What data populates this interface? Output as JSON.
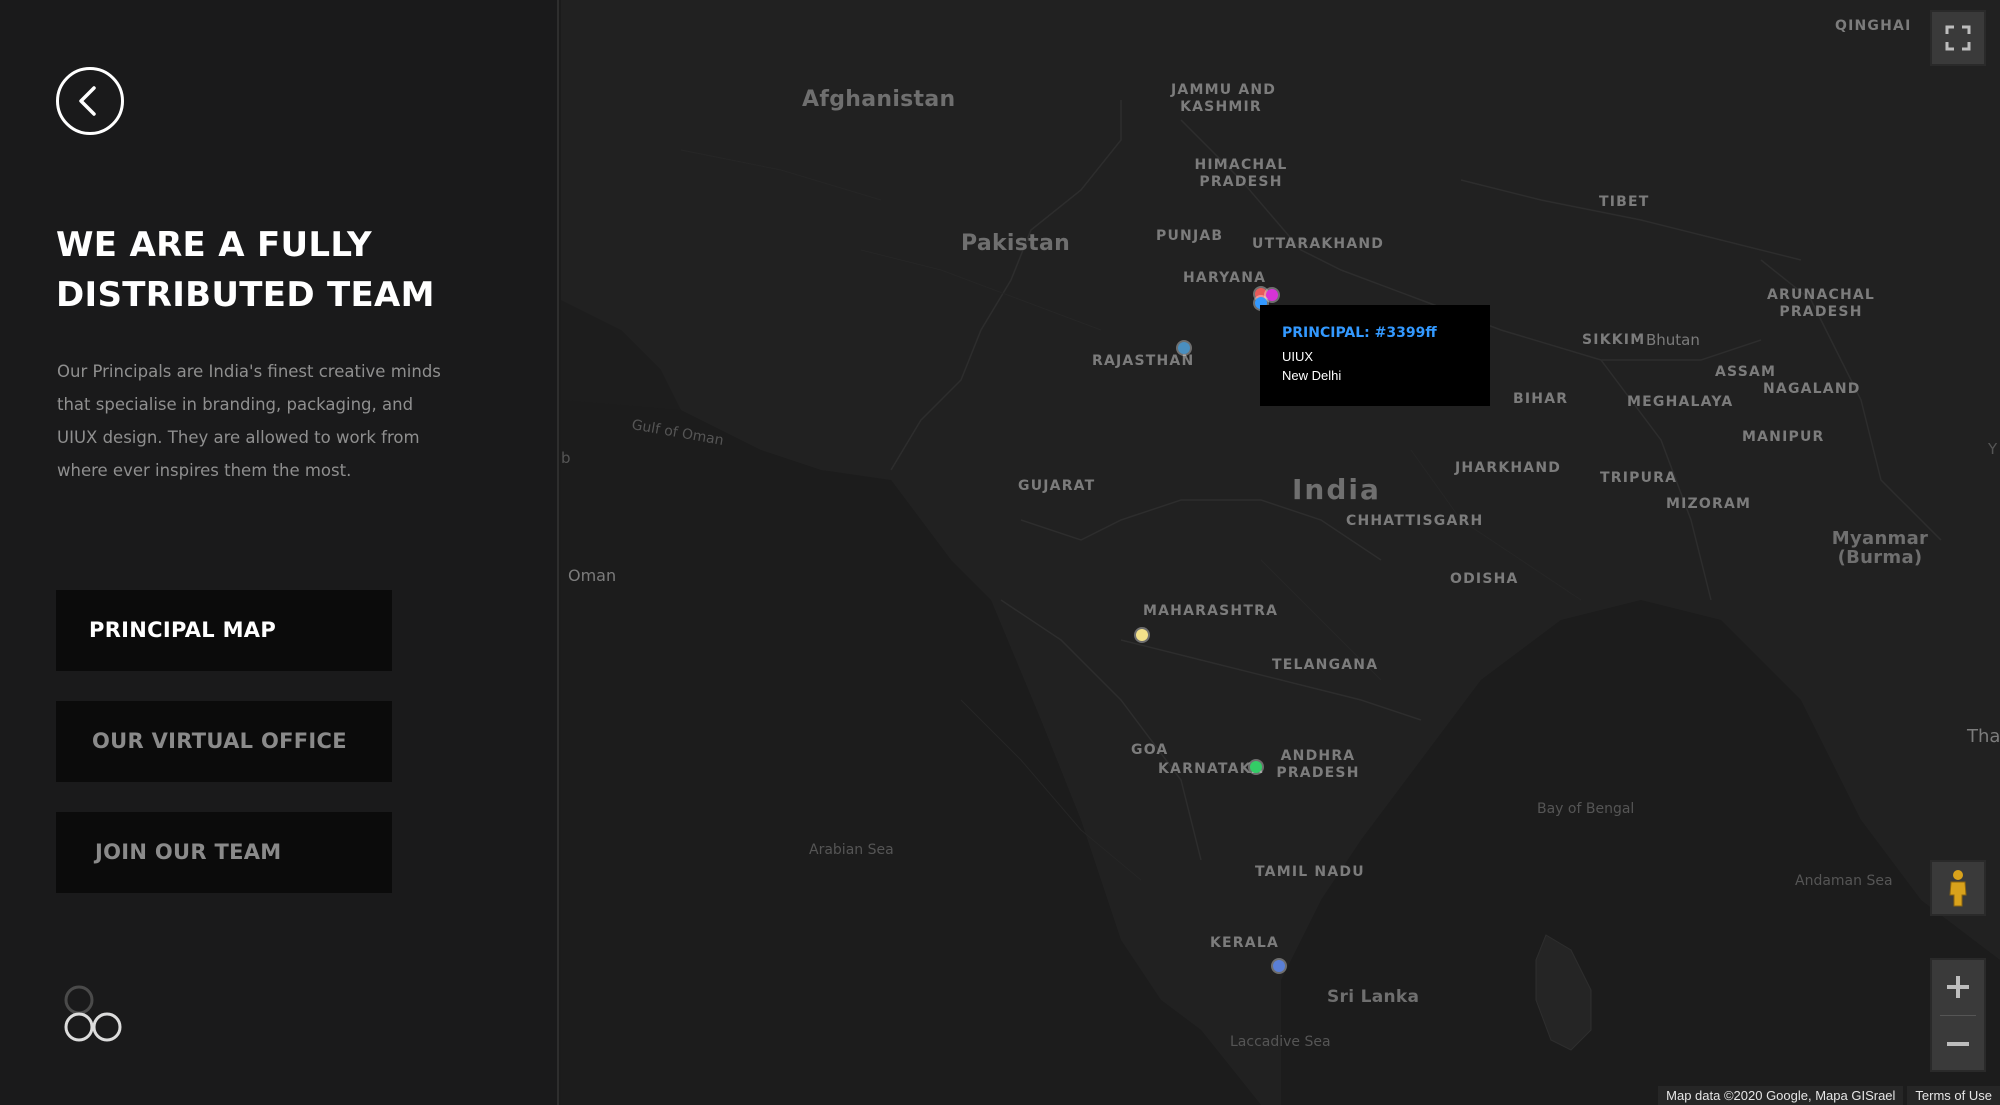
{
  "sidebar": {
    "headline_line1": "WE ARE A FULLY",
    "headline_line2": "DISTRIBUTED TEAM",
    "intro_line1": "Our Principals are India's finest creative minds",
    "intro_line2": "that specialise in branding, packaging, and",
    "intro_line3": "UIUX design. They are allowed to work from",
    "intro_line4": "where ever inspires them the most.",
    "nav": {
      "principal_map": "PRINCIPAL MAP",
      "virtual_office": "OUR VIRTUAL OFFICE",
      "join_team": "JOIN OUR TEAM"
    }
  },
  "map": {
    "labels": {
      "qinghai": "QINGHAI",
      "afghanistan": "Afghanistan",
      "jammu1": "JAMMU AND",
      "jammu2": "KASHMIR",
      "himachal1": "HIMACHAL",
      "himachal2": "PRADESH",
      "tibet": "TIBET",
      "pakistan": "Pakistan",
      "punjab": "PUNJAB",
      "uttarakhand": "UTTARAKHAND",
      "haryana": "HARYANA",
      "arunachal1": "ARUNACHAL",
      "arunachal2": "PRADESH",
      "rajasthan": "RAJASTHAN",
      "sikkim": "SIKKIM",
      "bhutan": "Bhutan",
      "assam": "ASSAM",
      "nagaland": "NAGALAND",
      "gulf_of_oman": "Gulf of Oman",
      "bihar": "BIHAR",
      "meghalaya": "MEGHALAYA",
      "manipur": "MANIPUR",
      "gujarat": "GUJARAT",
      "india": "India",
      "jharkhand": "JHARKHAND",
      "chhattisgarh": "CHHATTISGARH",
      "tripura": "TRIPURA",
      "mizoram": "MIZORAM",
      "oman": "Oman",
      "myanmar1": "Myanmar",
      "myanmar2": "(Burma)",
      "odisha": "ODISHA",
      "maharashtra": "MAHARASHTRA",
      "telangana": "TELANGANA",
      "goa": "GOA",
      "karnataka": "KARNATAKA",
      "andhra1": "ANDHRA",
      "andhra2": "PRADESH",
      "tha": "Tha",
      "bay_of_bengal": "Bay of Bengal",
      "arabian_sea": "Arabian Sea",
      "tamil_nadu": "TAMIL NADU",
      "andaman_sea": "Andaman Sea",
      "kerala": "KERALA",
      "sri_lanka": "Sri Lanka",
      "laccadive_sea": "Laccadive Sea",
      "edge_b": "b",
      "edge_y": "Y"
    },
    "markers": [
      {
        "name": "marker-new-delhi-red",
        "color": "#e85a5a"
      },
      {
        "name": "marker-new-delhi-magenta",
        "color": "#d633d6"
      },
      {
        "name": "marker-new-delhi-blue",
        "color": "#3399ff"
      },
      {
        "name": "marker-rajasthan",
        "color": "#4a8fc0"
      },
      {
        "name": "marker-mumbai",
        "color": "#f2e08a"
      },
      {
        "name": "marker-bangalore",
        "color": "#33cc66"
      },
      {
        "name": "marker-kerala",
        "color": "#5a7fd6"
      }
    ],
    "tooltip": {
      "title": "PRINCIPAL: #3399ff",
      "discipline": "UIUX",
      "city": "New Delhi"
    },
    "attribution": {
      "map_data": "Map data ©2020 Google, Mapa GISrael",
      "terms": "Terms of Use"
    }
  }
}
